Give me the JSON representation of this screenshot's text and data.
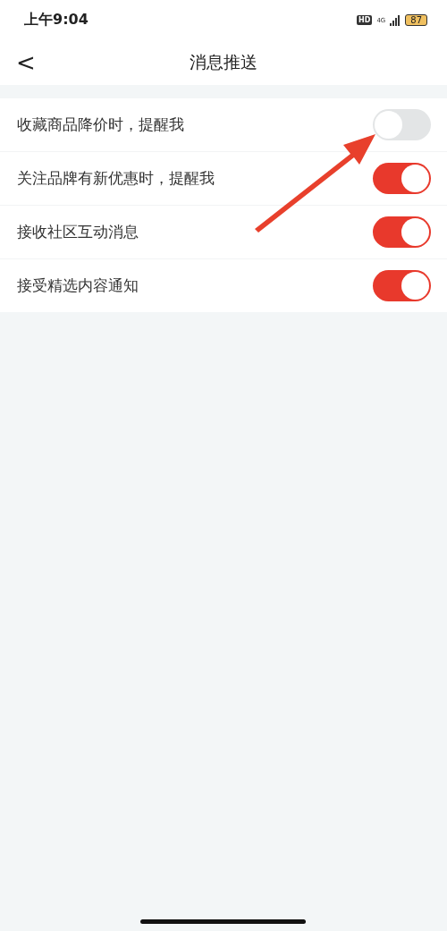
{
  "status_bar": {
    "time": "上午9:04",
    "hd": "HD",
    "network": "4G",
    "battery": "87"
  },
  "nav": {
    "back": "<",
    "title": "消息推送"
  },
  "settings": [
    {
      "label": "收藏商品降价时，提醒我",
      "on": false
    },
    {
      "label": "关注品牌有新优惠时，提醒我",
      "on": true
    },
    {
      "label": "接收社区互动消息",
      "on": true
    },
    {
      "label": "接受精选内容通知",
      "on": true
    }
  ]
}
